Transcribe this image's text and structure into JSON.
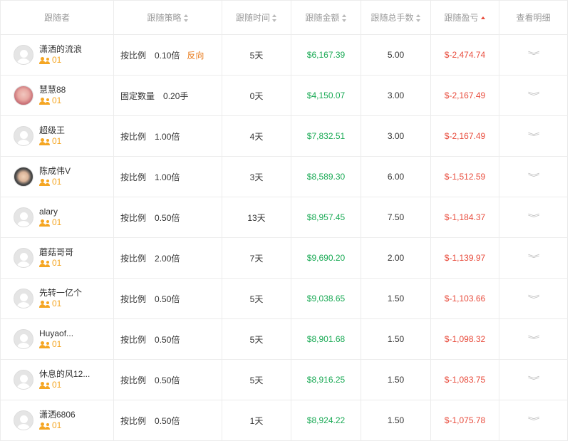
{
  "header": {
    "follower": "跟随者",
    "strategy": "跟随策略",
    "time": "跟随时间",
    "amount": "跟随金额",
    "lots": "跟随总手数",
    "pnl": "跟随盈亏",
    "details": "查看明细"
  },
  "colors": {
    "positive": "#1aaa55",
    "negative": "#e84c3d",
    "accent": "#f5a623",
    "reverse": "#e87a1a"
  },
  "rows": [
    {
      "name": "潇洒的流浪",
      "count": "01",
      "avatar": "default",
      "mode": "按比例",
      "mult": "0.10倍",
      "reverse": "反向",
      "time": "5天",
      "amount": "$6,167.39",
      "lots": "5.00",
      "pnl": "$-2,474.74"
    },
    {
      "name": "慧慧88",
      "count": "01",
      "avatar": "photo-pink",
      "mode": "固定数量",
      "mult": "0.20手",
      "reverse": "",
      "time": "0天",
      "amount": "$4,150.07",
      "lots": "3.00",
      "pnl": "$-2,167.49"
    },
    {
      "name": "超级王",
      "count": "01",
      "avatar": "default",
      "mode": "按比例",
      "mult": "1.00倍",
      "reverse": "",
      "time": "4天",
      "amount": "$7,832.51",
      "lots": "3.00",
      "pnl": "$-2,167.49"
    },
    {
      "name": "陈成伟V",
      "count": "01",
      "avatar": "photo-man",
      "mode": "按比例",
      "mult": "1.00倍",
      "reverse": "",
      "time": "3天",
      "amount": "$8,589.30",
      "lots": "6.00",
      "pnl": "$-1,512.59"
    },
    {
      "name": "alary",
      "count": "01",
      "avatar": "default",
      "mode": "按比例",
      "mult": "0.50倍",
      "reverse": "",
      "time": "13天",
      "amount": "$8,957.45",
      "lots": "7.50",
      "pnl": "$-1,184.37"
    },
    {
      "name": "蘑菇哥哥",
      "count": "01",
      "avatar": "default",
      "mode": "按比例",
      "mult": "2.00倍",
      "reverse": "",
      "time": "7天",
      "amount": "$9,690.20",
      "lots": "2.00",
      "pnl": "$-1,139.97"
    },
    {
      "name": "先转一亿个",
      "count": "01",
      "avatar": "default",
      "mode": "按比例",
      "mult": "0.50倍",
      "reverse": "",
      "time": "5天",
      "amount": "$9,038.65",
      "lots": "1.50",
      "pnl": "$-1,103.66"
    },
    {
      "name": "Huyaof...",
      "count": "01",
      "avatar": "default",
      "mode": "按比例",
      "mult": "0.50倍",
      "reverse": "",
      "time": "5天",
      "amount": "$8,901.68",
      "lots": "1.50",
      "pnl": "$-1,098.32"
    },
    {
      "name": "休息的风12...",
      "count": "01",
      "avatar": "default",
      "mode": "按比例",
      "mult": "0.50倍",
      "reverse": "",
      "time": "5天",
      "amount": "$8,916.25",
      "lots": "1.50",
      "pnl": "$-1,083.75"
    },
    {
      "name": "潇洒6806",
      "count": "01",
      "avatar": "default",
      "mode": "按比例",
      "mult": "0.50倍",
      "reverse": "",
      "time": "1天",
      "amount": "$8,924.22",
      "lots": "1.50",
      "pnl": "$-1,075.78"
    }
  ]
}
